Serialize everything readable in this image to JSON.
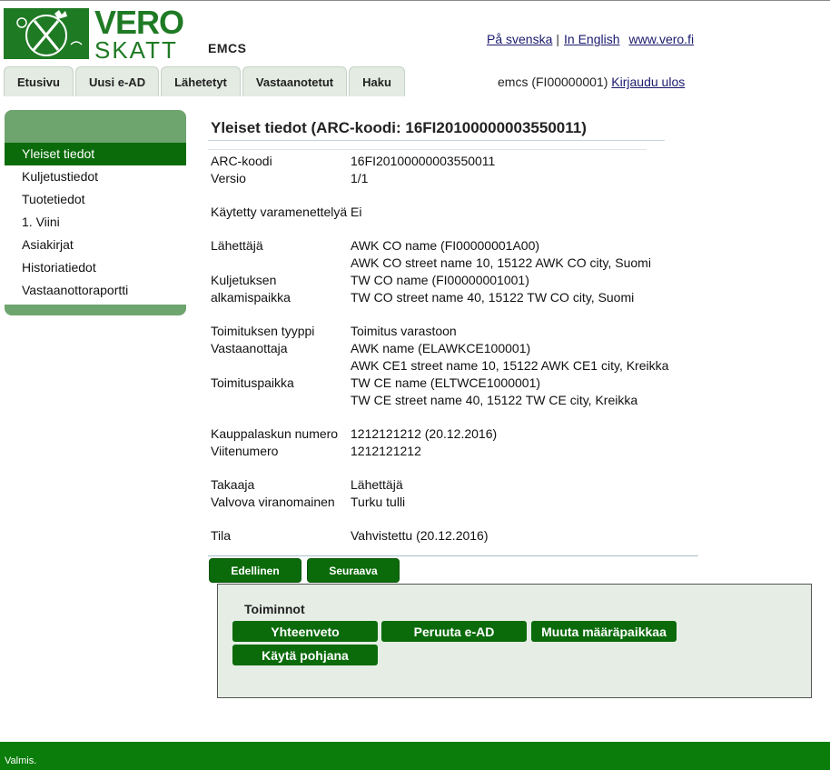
{
  "header": {
    "logo_top": "VERO",
    "logo_bottom": "SKATT",
    "app_title": "EMCS",
    "links": {
      "swedish": "På svenska",
      "english": "In English",
      "site": "www.vero.fi"
    },
    "user": "emcs (FI00000001)",
    "logout": "Kirjaudu ulos"
  },
  "tabs": [
    "Etusivu",
    "Uusi e-AD",
    "Lähetetyt",
    "Vastaanotetut",
    "Haku"
  ],
  "sidebar": {
    "items": [
      "Yleiset tiedot",
      "Kuljetustiedot",
      "Tuotetiedot",
      "1. Viini",
      "Asiakirjat",
      "Historiatiedot",
      "Vastaanottoraportti"
    ],
    "active_index": 0
  },
  "main": {
    "title": "Yleiset tiedot (ARC-koodi: 16FI20100000003550011)",
    "rows": [
      {
        "label": "ARC-koodi",
        "value": "16FI20100000003550011"
      },
      {
        "label": "Versio",
        "value": "1/1"
      },
      {
        "label": "Käytetty varamenettelyä",
        "value": "Ei"
      },
      {
        "label": "Lähettäjä",
        "value": "AWK CO name (FI00000001A00)"
      },
      {
        "label": "",
        "value": "AWK CO street name 10, 15122 AWK CO city, Suomi"
      },
      {
        "label": "Kuljetuksen alkamispaikka",
        "value": "TW CO name (FI00000001001)"
      },
      {
        "label": "",
        "value": "TW CO street name 40, 15122 TW CO city, Suomi"
      },
      {
        "label": "Toimituksen tyyppi",
        "value": "Toimitus varastoon"
      },
      {
        "label": "Vastaanottaja",
        "value": "AWK name (ELAWKCE100001)"
      },
      {
        "label": "",
        "value": "AWK CE1 street name 10, 15122 AWK CE1 city, Kreikka"
      },
      {
        "label": "Toimituspaikka",
        "value": "TW CE name (ELTWCE1000001)"
      },
      {
        "label": "",
        "value": "TW CE street name 40, 15122 TW CE city, Kreikka"
      },
      {
        "label": "Kauppalaskun numero",
        "value": "1212121212 (20.12.2016)"
      },
      {
        "label": "Viitenumero",
        "value": "1212121212"
      },
      {
        "label": "Takaaja",
        "value": "Lähettäjä"
      },
      {
        "label": "Valvova viranomainen",
        "value": "Turku tulli"
      },
      {
        "label": "Tila",
        "value": "Vahvistettu (20.12.2016)"
      }
    ],
    "prev_button": "Edellinen",
    "next_button": "Seuraava"
  },
  "actions": {
    "title": "Toiminnot",
    "buttons": [
      "Yhteenveto",
      "Peruuta e-AD",
      "Muuta määräpaikkaa",
      "Käytä pohjana"
    ]
  },
  "status": "Valmis.",
  "colors": {
    "brand_green": "#0b6b0b",
    "sidebar_green": "#6ea46e",
    "panel_bg": "#e5ede5"
  }
}
